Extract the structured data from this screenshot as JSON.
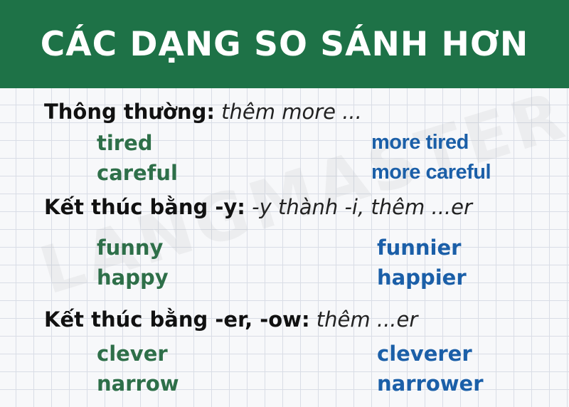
{
  "title": "CÁC DẠNG SO SÁNH HƠN",
  "watermark": "LANGMASTER",
  "sections": [
    {
      "label": "Thông thường:",
      "rule": "thêm more ...",
      "pairs": [
        {
          "base": "tired",
          "comparative": "more tired"
        },
        {
          "base": "careful",
          "comparative": "more careful"
        }
      ]
    },
    {
      "label": "Kết thúc bằng -y:",
      "rule": "-y thành -i, thêm ...er",
      "pairs": [
        {
          "base": "funny",
          "comparative": "funnier"
        },
        {
          "base": "happy",
          "comparative": "happier"
        }
      ]
    },
    {
      "label": "Kết thúc bằng -er, -ow:",
      "rule": "thêm ...er",
      "pairs": [
        {
          "base": "clever",
          "comparative": "cleverer"
        },
        {
          "base": "narrow",
          "comparative": "narrower"
        }
      ]
    }
  ],
  "colors": {
    "header_bg": "#1e7247",
    "base_word": "#2e6f49",
    "comparative_word": "#1b5fa8"
  }
}
